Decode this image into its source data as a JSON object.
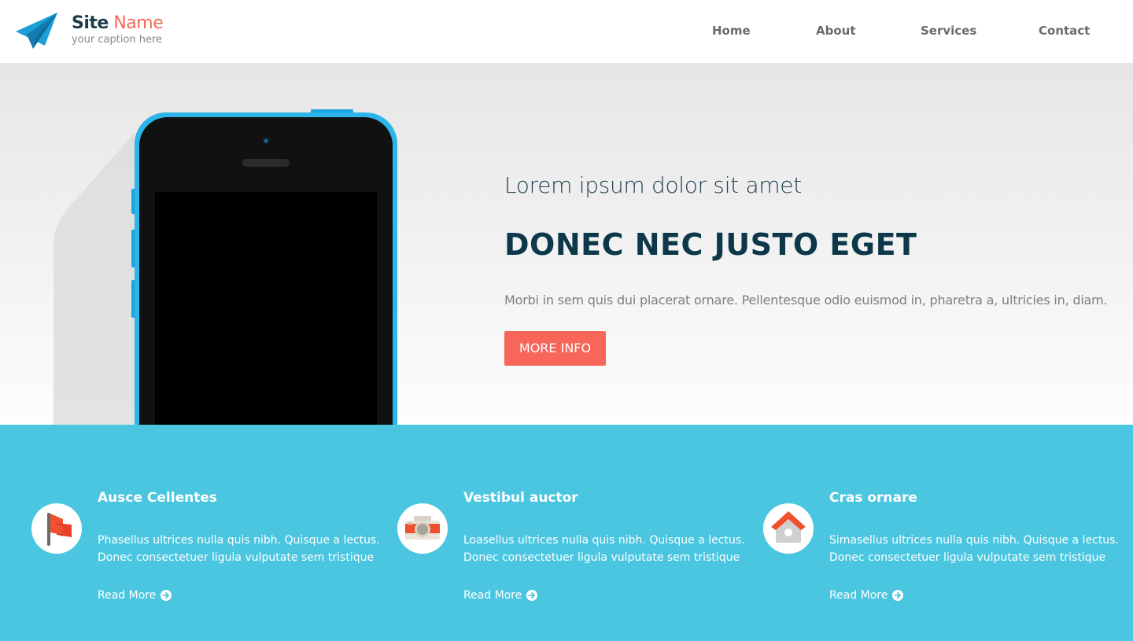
{
  "header": {
    "site_name_bold": "Site",
    "site_name_light": "Name",
    "caption": "your caption here",
    "logo_icon": "paper-plane-icon",
    "nav": [
      {
        "label": "Home"
      },
      {
        "label": "About"
      },
      {
        "label": "Services"
      },
      {
        "label": "Contact"
      }
    ]
  },
  "hero": {
    "subtitle": "Lorem ipsum dolor sit amet",
    "title": "DONEC NEC JUSTO EGET",
    "text": "Morbi in sem quis dui placerat ornare. Pellentesque odio euismod in, pharetra a, ultricies in, diam.",
    "button_label": "MORE INFO",
    "image": "smartphone-illustration"
  },
  "features": [
    {
      "icon": "flag-icon",
      "title": "Ausce Cellentes",
      "text_line1": "Phasellus ultrices nulla quis nibh. Quisque a lectus.",
      "text_line2": "Donec consectetuer ligula vulputate sem tristique",
      "link": "Read More"
    },
    {
      "icon": "camera-icon",
      "title": "Vestibul auctor",
      "text_line1": "Loasellus ultrices nulla quis nibh. Quisque a lectus.",
      "text_line2": "Donec consectetuer ligula vulputate sem tristique",
      "link": "Read More"
    },
    {
      "icon": "house-icon",
      "title": "Cras ornare",
      "text_line1": "Simasellus ultrices nulla quis nibh. Quisque a lectus.",
      "text_line2": "Donec consectetuer ligula vulputate sem tristique",
      "link": "Read More"
    }
  ],
  "colors": {
    "accent": "#f8655a",
    "brand_dark": "#0d3849",
    "features_bg": "#4ac6e0",
    "logo_blue": "#1ca0d8"
  }
}
